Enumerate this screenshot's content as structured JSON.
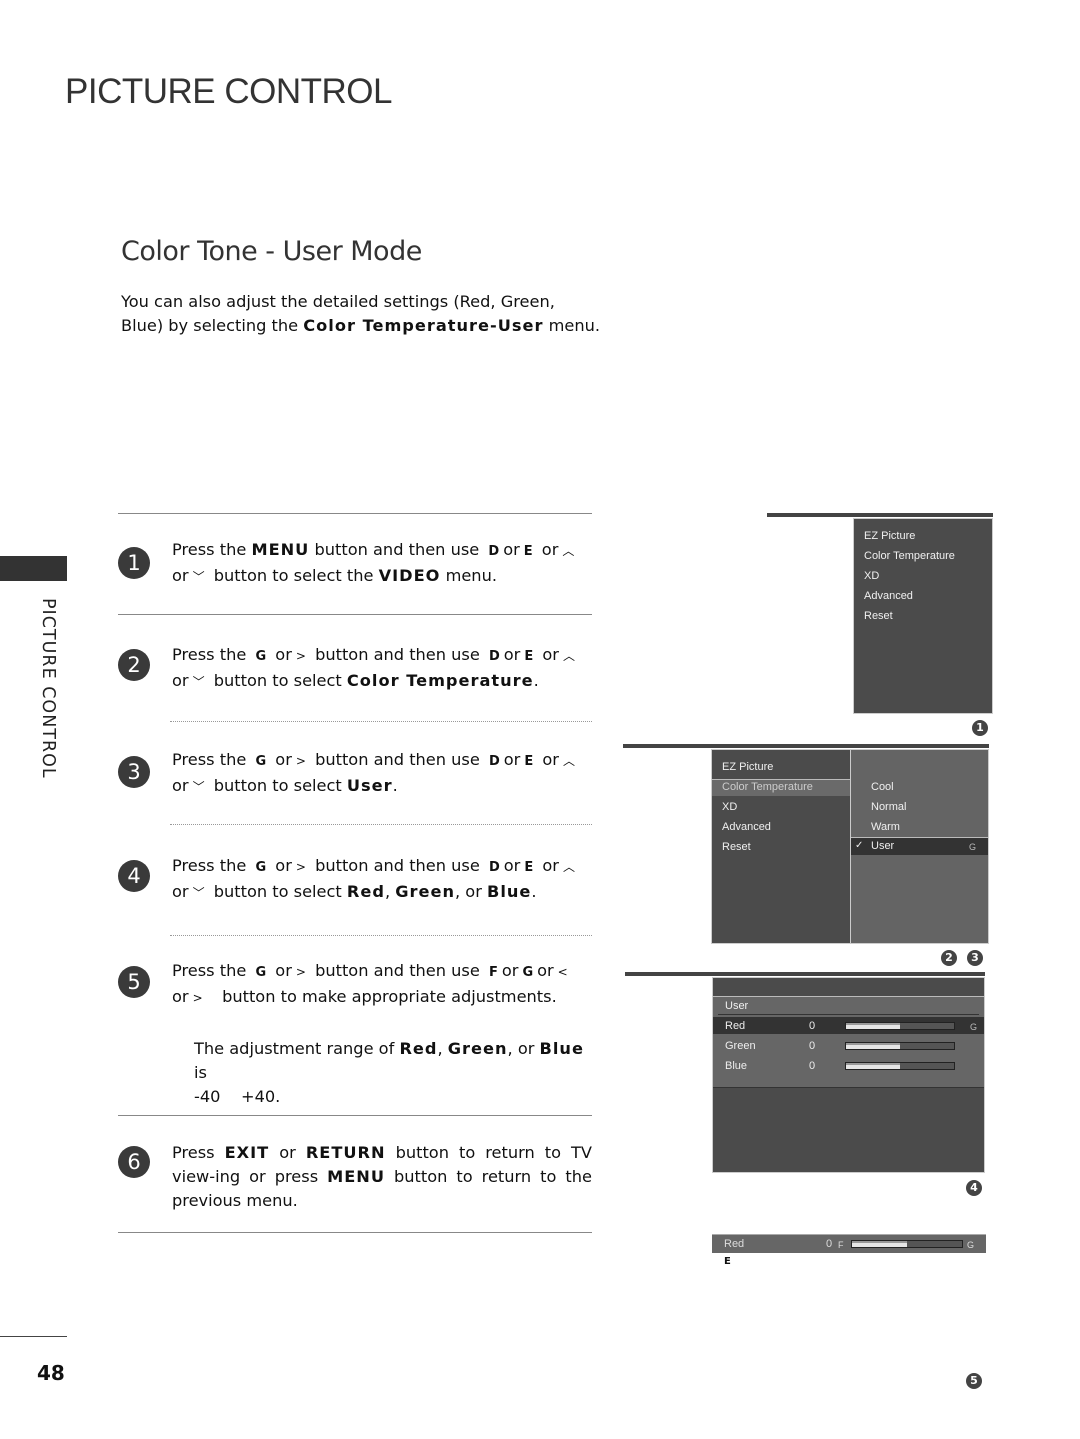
{
  "header": {
    "title": "PICTURE CONTROL"
  },
  "section": {
    "title": "Color Tone - User Mode",
    "intro_1": "You can also adjust the detailed settings (Red, Green, Blue) by selecting the ",
    "intro_bold": "Color Temperature-User",
    "intro_2": " menu."
  },
  "sidebar": {
    "label": "PICTURE CONTROL"
  },
  "footer": {
    "page_number": "48"
  },
  "keys": {
    "up_d": "D",
    "down_e": "E",
    "right_g": "G",
    "left_f": "F",
    "up_arrow": "^",
    "down_arrow": "v",
    "right_arrow": ">",
    "left_arrow": "<",
    "or": "or"
  },
  "steps": [
    {
      "num": "1",
      "t1": "Press the ",
      "b1": "MENU",
      "t2": " button and then use ",
      "t3": " button to select the ",
      "b2": "VIDEO",
      "t4": " menu."
    },
    {
      "num": "2",
      "t1": "Press the ",
      "t2": " button and then use ",
      "t3": " button to select ",
      "b1": "Color Temperature",
      "t4": "."
    },
    {
      "num": "3",
      "t1": "Press the ",
      "t2": " button and then use ",
      "t3": " button to select ",
      "b1": "User",
      "t4": "."
    },
    {
      "num": "4",
      "t1": "Press the ",
      "t2": " button and then use ",
      "t3": " button to select ",
      "b1": "Red",
      "s1": ", ",
      "b2": "Green",
      "s2": ", or ",
      "b3": "Blue",
      "t4": "."
    },
    {
      "num": "5",
      "t1": "Press the ",
      "t2": " button and then use ",
      "t3": " button to make appropriate adjustments.",
      "note_1": "The adjustment range of ",
      "nb1": "Red",
      "ns1": ", ",
      "nb2": "Green",
      "ns2": ", or ",
      "nb3": "Blue",
      "note_2": " is",
      "range": "-40    +40."
    },
    {
      "num": "6",
      "t1": "Press ",
      "b1": "EXIT",
      "t2": " or ",
      "b2": "RETURN",
      "t3": " button to return to TV view-ing or press ",
      "b3": "MENU",
      "t4": " button to return to the previous menu."
    }
  ],
  "osd": {
    "menu_items": [
      "EZ Picture",
      "Color Temperature",
      "XD",
      "Advanced",
      "Reset"
    ],
    "color_temp_options": [
      "Cool",
      "Normal",
      "Warm",
      "User"
    ],
    "selected_option": "User",
    "check": "✓",
    "right_key": "G",
    "left_key": "F",
    "down_key": "E",
    "user_title": "User",
    "channels": [
      {
        "label": "Red",
        "value": "0",
        "level": 0.5
      },
      {
        "label": "Green",
        "value": "0",
        "level": 0.5
      },
      {
        "label": "Blue",
        "value": "0",
        "level": 0.5
      }
    ],
    "adjust": {
      "label": "Red",
      "value": "0",
      "level": 0.5
    },
    "badges": [
      "1",
      "2",
      "3",
      "4",
      "5"
    ]
  }
}
